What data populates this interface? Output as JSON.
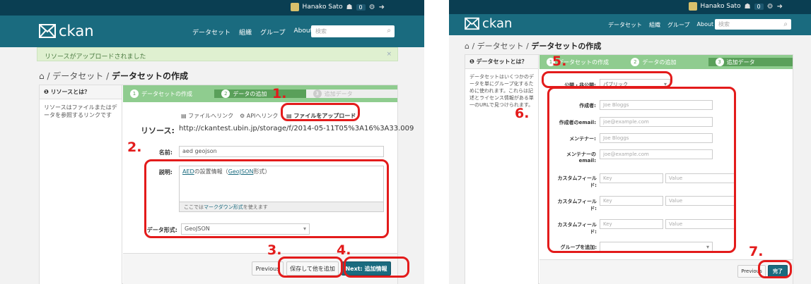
{
  "left": {
    "user": {
      "name": "Hanako Sato",
      "count": "0"
    },
    "logo": "ckan",
    "nav": [
      "データセット",
      "組織",
      "グループ",
      "About"
    ],
    "search_placeholder": "検索",
    "flash": {
      "text": "リソースがアップロードされました",
      "close": "×"
    },
    "breadcrumb": {
      "home": "/ データセット / ",
      "current": "データセットの作成"
    },
    "sidebar": {
      "title": "リソースとは？",
      "text": "リソースはファイルまたはデータを参照するリンクです"
    },
    "stages": [
      "データセットの作成",
      "データの追加",
      "追加データ"
    ],
    "source_options": [
      "ファイルへリンク",
      "APIへリンク",
      "ファイルをアップロード"
    ],
    "resource_label": "リソース:",
    "resource_url": "http://ckantest.ubin.jp/storage/f/2014-05-11T05%3A16%3A33.009",
    "name_label": "名前:",
    "name_value": "aed geojson",
    "desc_label": "説明:",
    "desc_value_prefix": "AED",
    "desc_value_mid": "の設置情報（",
    "desc_value_link": "GeoJSON",
    "desc_value_suffix": "形式）",
    "markdown_prefix": "ここでは",
    "markdown_link": "マークダウン形式",
    "markdown_suffix": "を使えます",
    "format_label": "データ形式:",
    "format_value": "GeoJSON",
    "buttons": {
      "previous": "Previous",
      "save_add": "保存して他を追加",
      "next": "Next: 追加情報"
    },
    "callouts": [
      "1.",
      "2.",
      "3.",
      "4."
    ]
  },
  "right": {
    "user": {
      "name": "Hanako Sato",
      "count": "0"
    },
    "logo": "ckan",
    "nav": [
      "データセット",
      "組織",
      "グループ",
      "About"
    ],
    "search_placeholder": "検索",
    "breadcrumb": {
      "home": "/ データセット / ",
      "current": "データセットの作成"
    },
    "sidebar": {
      "title": "データセットとは？",
      "text": "データセットはいくつかのデータを単にグループ化するために使われます。これらは記述とライセンス情報がある単一のURLで見つけられます。"
    },
    "stages": [
      "データセットの作成",
      "データの追加",
      "追加データ"
    ],
    "visibility_label": "公開・非公開:",
    "visibility_value": "パブリック",
    "author_label": "作成者:",
    "author_placeholder": "Joe Bloggs",
    "author_email_label": "作成者のemail:",
    "author_email_placeholder": "joe@example.com",
    "maintainer_label": "メンテナー:",
    "maintainer_placeholder": "Joe Bloggs",
    "maintainer_email_label": "メンテナーの email:",
    "maintainer_email_placeholder": "joe@example.com",
    "custom_label": "カスタムフィールド:",
    "key_placeholder": "Key",
    "value_placeholder": "Value",
    "group_label": "グループを追加:",
    "buttons": {
      "previous": "Previous",
      "finish": "完了"
    },
    "callouts": [
      "5.",
      "6.",
      "7."
    ]
  }
}
